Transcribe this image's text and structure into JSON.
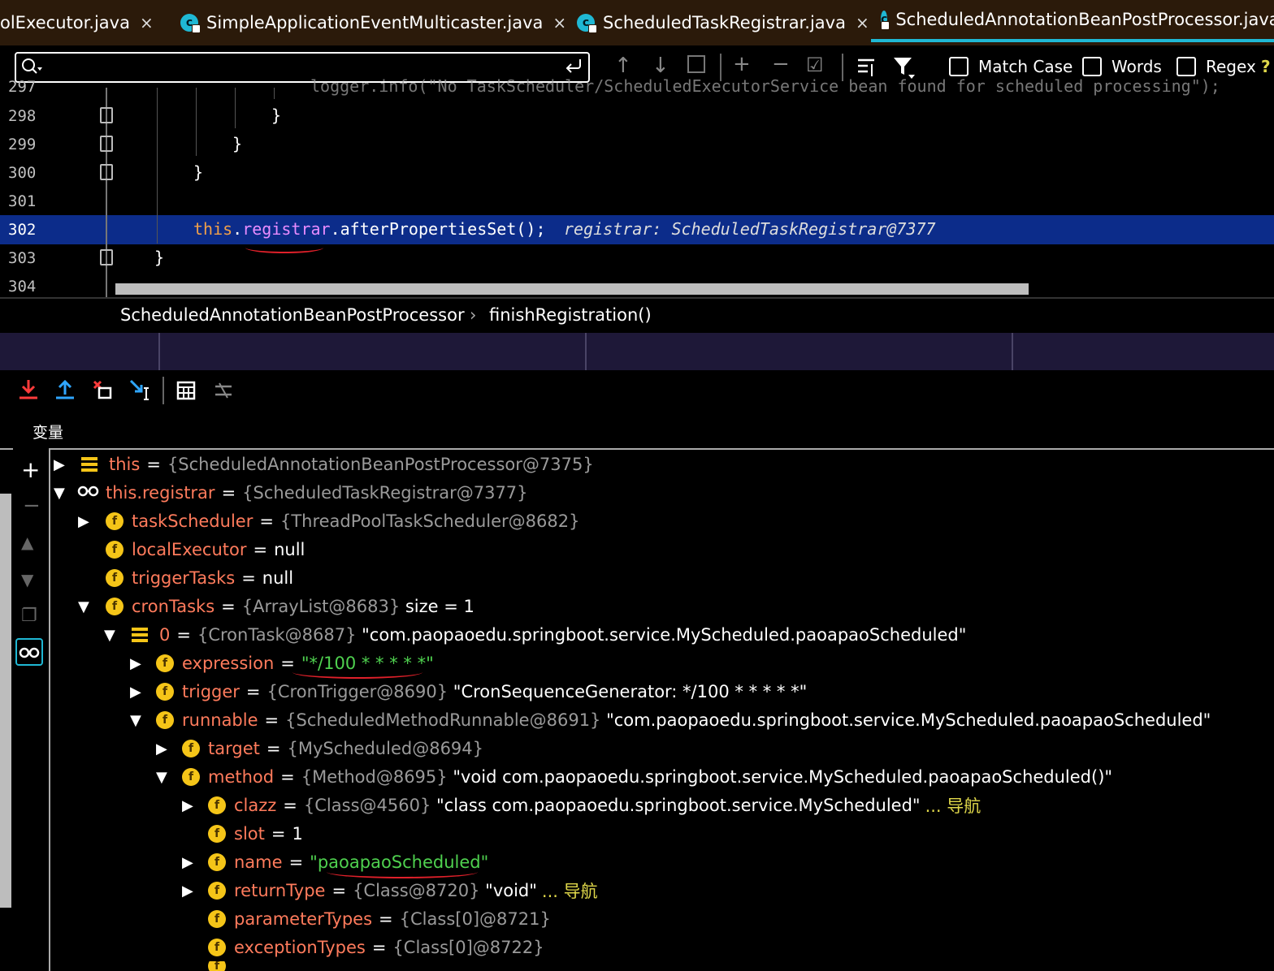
{
  "tabs": [
    {
      "label": "olExecutor.java",
      "close": "×"
    },
    {
      "label": "SimpleApplicationEventMulticaster.java",
      "close": "×"
    },
    {
      "label": "ScheduledTaskRegistrar.java",
      "close": "×"
    },
    {
      "label": "ScheduledAnnotationBeanPostProcessor.java",
      "close": ""
    }
  ],
  "search": {
    "value": "",
    "placeholder": ""
  },
  "find_options": {
    "match_case": "Match Case",
    "words": "Words",
    "regex": "Regex",
    "help": "?"
  },
  "editor": {
    "lines": [
      {
        "num": "297",
        "text": "logger.info(\"No TaskScheduler/ScheduledExecutorService bean found for scheduled processing\");"
      },
      {
        "num": "298",
        "text": "}"
      },
      {
        "num": "299",
        "text": "}"
      },
      {
        "num": "300",
        "text": "}"
      },
      {
        "num": "301",
        "text": ""
      },
      {
        "num": "302",
        "text_this": "this",
        "text_dot1": ".",
        "text_field": "registrar",
        "text_rest": ".afterPropertiesSet();",
        "hint": "registrar: ScheduledTaskRegistrar@7377"
      },
      {
        "num": "303",
        "text": "}"
      },
      {
        "num": "304",
        "text": ""
      }
    ]
  },
  "breadcrumb": {
    "class": "ScheduledAnnotationBeanPostProcessor",
    "sep": "›",
    "method": "finishRegistration()"
  },
  "variables_header": "变量",
  "variables": [
    {
      "name": "this",
      "ref": "{ScheduledAnnotationBeanPostProcessor@7375}",
      "tail": ""
    },
    {
      "name": "this.registrar",
      "ref": "{ScheduledTaskRegistrar@7377}",
      "tail": ""
    },
    {
      "name": "taskScheduler",
      "ref": "{ThreadPoolTaskScheduler@8682}",
      "tail": ""
    },
    {
      "name": "localExecutor",
      "ref": "",
      "tail": "null"
    },
    {
      "name": "triggerTasks",
      "ref": "",
      "tail": "null"
    },
    {
      "name": "cronTasks",
      "ref": "{ArrayList@8683}",
      "tail": " size = 1"
    },
    {
      "name": "0",
      "ref": "{CronTask@8687}",
      "tail": " \"com.paopaoedu.springboot.service.MyScheduled.paoapaoScheduled\""
    },
    {
      "name": "expression",
      "ref": "",
      "tail": "\"*/100 * * * * *\""
    },
    {
      "name": "trigger",
      "ref": "{CronTrigger@8690}",
      "tail": " \"CronSequenceGenerator: */100 * * * * *\""
    },
    {
      "name": "runnable",
      "ref": "{ScheduledMethodRunnable@8691}",
      "tail": " \"com.paopaoedu.springboot.service.MyScheduled.paoapaoScheduled\""
    },
    {
      "name": "target",
      "ref": "{MyScheduled@8694}",
      "tail": ""
    },
    {
      "name": "method",
      "ref": "{Method@8695}",
      "tail": " \"void com.paopaoedu.springboot.service.MyScheduled.paoapaoScheduled()\""
    },
    {
      "name": "clazz",
      "ref": "{Class@4560}",
      "tail": " \"class com.paopaoedu.springboot.service.MyScheduled\"",
      "nav": "... 导航"
    },
    {
      "name": "slot",
      "ref": "",
      "tail": "1"
    },
    {
      "name": "name",
      "ref": "",
      "tail": "\"paoapaoScheduled\""
    },
    {
      "name": "returnType",
      "ref": "{Class@8720}",
      "tail": " \"void\"",
      "nav": "... 导航"
    },
    {
      "name": "parameterTypes",
      "ref": "{Class[0]@8721}",
      "tail": ""
    },
    {
      "name": "exceptionTypes",
      "ref": "{Class[0]@8722}",
      "tail": ""
    }
  ],
  "icons": {
    "class_icon": "c-circle-icon",
    "field_icon": "f-circle-icon",
    "watch_icon": "glasses-icon"
  },
  "colors": {
    "tab_bar": "#2b1a0a",
    "accent": "#1fb8d4",
    "highlight": "#0c2c8a",
    "field_name": "#ff7b5c",
    "string": "#4fd14f",
    "annotation_red": "#e0202a"
  }
}
